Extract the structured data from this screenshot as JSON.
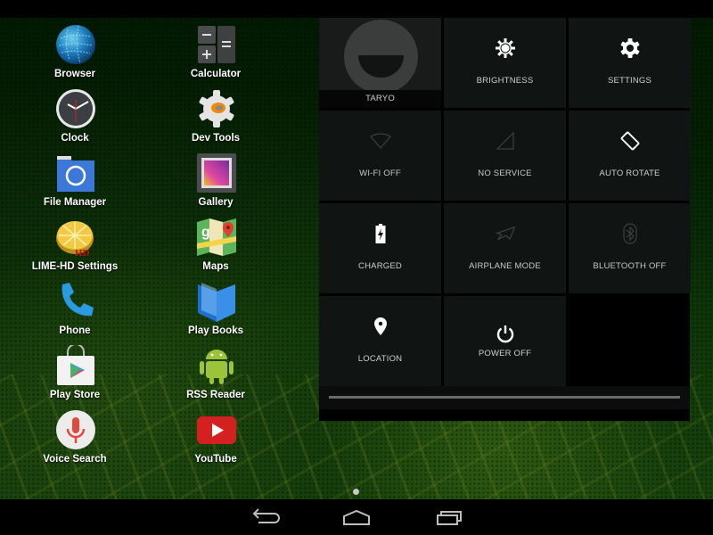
{
  "apps": [
    {
      "label": "Browser",
      "icon": "globe-icon"
    },
    {
      "label": "Calculator",
      "icon": "calculator-icon"
    },
    {
      "label": "Clock",
      "icon": "clock-icon"
    },
    {
      "label": "Dev Tools",
      "icon": "gear-icon"
    },
    {
      "label": "File Manager",
      "icon": "folder-icon"
    },
    {
      "label": "Gallery",
      "icon": "picture-icon"
    },
    {
      "label": "LIME-HD Settings",
      "icon": "lime-icon"
    },
    {
      "label": "Maps",
      "icon": "map-icon"
    },
    {
      "label": "Phone",
      "icon": "phone-icon"
    },
    {
      "label": "Play Books",
      "icon": "book-icon"
    },
    {
      "label": "Play Store",
      "icon": "shopping-bag-icon"
    },
    {
      "label": "RSS Reader",
      "icon": "android-icon"
    },
    {
      "label": "Voice Search",
      "icon": "microphone-icon"
    },
    {
      "label": "YouTube",
      "icon": "play-icon"
    }
  ],
  "quick_settings": {
    "user": {
      "name": "TARYO",
      "icon": "avatar-icon"
    },
    "tiles": [
      {
        "label": "BRIGHTNESS",
        "icon": "brightness-icon",
        "active": true
      },
      {
        "label": "SETTINGS",
        "icon": "settings-icon",
        "active": true
      },
      {
        "label": "WI-FI OFF",
        "icon": "wifi-icon",
        "active": false
      },
      {
        "label": "NO SERVICE",
        "icon": "signal-icon",
        "active": false
      },
      {
        "label": "AUTO ROTATE",
        "icon": "rotate-icon",
        "active": true
      },
      {
        "label": "CHARGED",
        "icon": "battery-icon",
        "active": true
      },
      {
        "label": "AIRPLANE MODE",
        "icon": "airplane-icon",
        "active": false
      },
      {
        "label": "BLUETOOTH OFF",
        "icon": "bluetooth-icon",
        "active": false
      },
      {
        "label": "LOCATION",
        "icon": "location-icon",
        "active": true
      },
      {
        "label": "POWER OFF",
        "icon": "power-icon",
        "active": true
      }
    ],
    "brightness_level": 1.0
  },
  "home_pages": {
    "count": 1,
    "current": 1
  },
  "navigation": {
    "back": "back-icon",
    "home": "home-icon",
    "recents": "recents-icon"
  }
}
